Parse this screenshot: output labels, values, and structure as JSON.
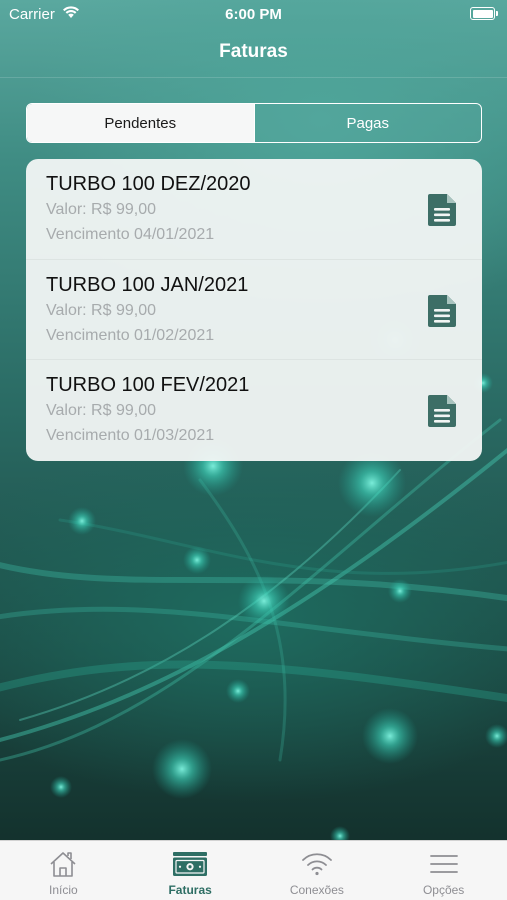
{
  "status_bar": {
    "carrier": "Carrier",
    "time": "6:00 PM"
  },
  "nav": {
    "title": "Faturas"
  },
  "segment": {
    "items": [
      {
        "label": "Pendentes",
        "selected": true
      },
      {
        "label": "Pagas",
        "selected": false
      }
    ]
  },
  "invoices": [
    {
      "name": "TURBO 100 DEZ/2020",
      "value": "Valor: R$ 99,00",
      "due": "Vencimento 04/01/2021",
      "icon": "document-icon"
    },
    {
      "name": "TURBO 100 JAN/2021",
      "value": "Valor: R$ 99,00",
      "due": "Vencimento 01/02/2021",
      "icon": "document-icon"
    },
    {
      "name": "TURBO 100 FEV/2021",
      "value": "Valor: R$ 99,00",
      "due": "Vencimento 01/03/2021",
      "icon": "document-icon"
    }
  ],
  "tabbar": {
    "items": [
      {
        "label": "Início",
        "icon": "home-icon",
        "active": false
      },
      {
        "label": "Faturas",
        "icon": "money-icon",
        "active": true
      },
      {
        "label": "Conexões",
        "icon": "wifi-icon",
        "active": false
      },
      {
        "label": "Opções",
        "icon": "menu-icon",
        "active": false
      }
    ]
  },
  "colors": {
    "accent": "#2e6e64",
    "icon": "#3d6e66",
    "secondary_text": "#a7abad"
  }
}
